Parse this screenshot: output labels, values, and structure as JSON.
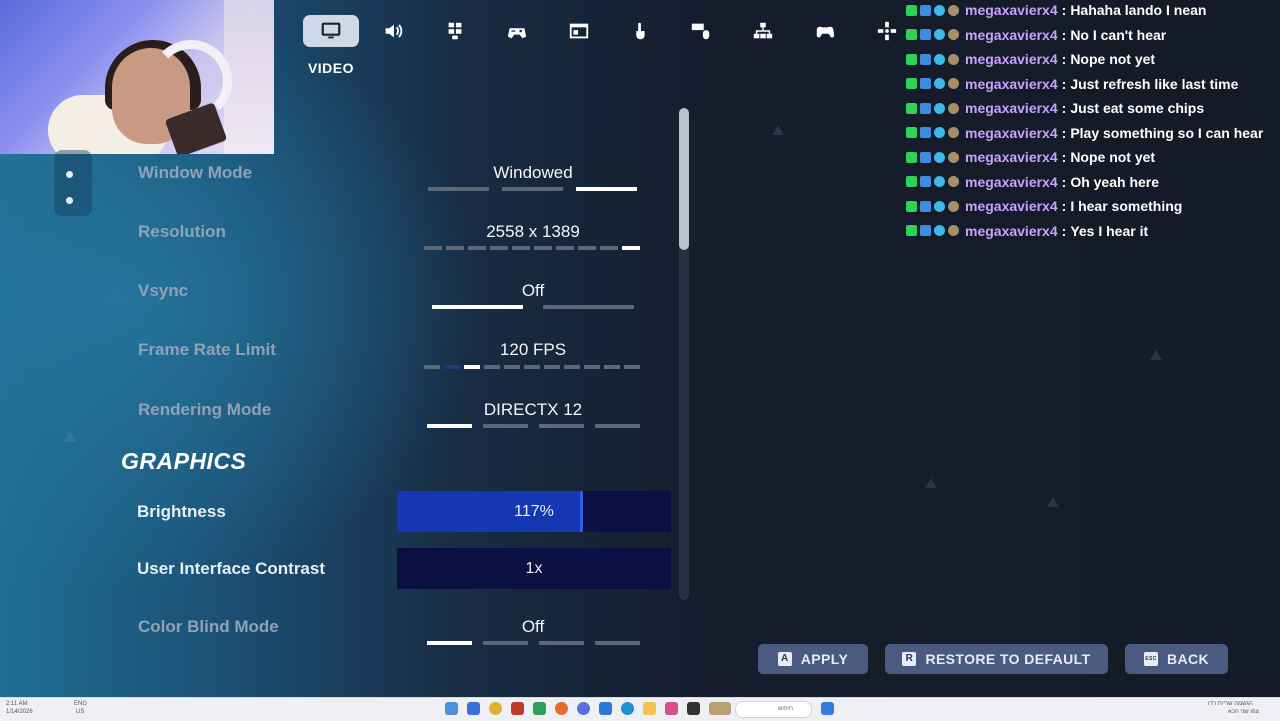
{
  "nav": {
    "active_tab_label": "VIDEO",
    "icons": [
      "monitor-icon",
      "speaker-icon",
      "controller-grid-icon",
      "gamepad-wireless-icon",
      "window-icon",
      "touch-icon",
      "keyboard-mouse-icon",
      "network-icon",
      "controller-icon",
      "gamepad-icon"
    ]
  },
  "settings": {
    "window_mode": {
      "label": "Window Mode",
      "value": "Windowed",
      "option_count": 3,
      "selected_index": 2
    },
    "resolution": {
      "label": "Resolution",
      "value": "2558 x 1389",
      "option_count": 10,
      "selected_index": 9
    },
    "vsync": {
      "label": "Vsync",
      "value": "Off",
      "option_count": 2,
      "selected_index": 0
    },
    "frame_rate_limit": {
      "label": "Frame Rate Limit",
      "value": "120 FPS",
      "option_count": 11,
      "selected_index": 2
    },
    "rendering_mode": {
      "label": "Rendering Mode",
      "value": "DIRECTX 12",
      "option_count": 4,
      "selected_index": 0
    }
  },
  "graphics": {
    "header": "GRAPHICS",
    "brightness": {
      "label": "Brightness",
      "value": "117%",
      "fill_fraction": 0.68
    },
    "ui_contrast": {
      "label": "User Interface Contrast",
      "value": "1x",
      "fill_fraction": 0.0
    },
    "color_blind_mode": {
      "label": "Color Blind Mode",
      "value": "Off",
      "option_count": 4,
      "selected_index": 0
    }
  },
  "chat": {
    "username": "megaxavierx4",
    "separator": ":",
    "messages": [
      "Hahaha lando I nean",
      "No I can't hear",
      "Nope not yet",
      "Just refresh like last time",
      "Just eat some chips",
      "Play something so I can hear",
      "Nope not yet",
      "Oh yeah here",
      "I hear something",
      "Yes I hear it"
    ]
  },
  "buttons": {
    "apply": {
      "key": "A",
      "label": "APPLY"
    },
    "restore": {
      "key": "R",
      "label": "RESTORE TO DEFAULT"
    },
    "back": {
      "key": "ESC",
      "label": "BACK"
    }
  },
  "taskbar": {
    "time": "2:11 AM",
    "date": "1/14/2026",
    "lang": "ENG",
    "region": "US",
    "search_placeholder": "חיפוש",
    "notification_text": "הגשמה שריית רדו",
    "notification_sub": "צפו שני הכא"
  },
  "colors": {
    "accent_blue": "#1637b3",
    "bar_track": "#0b0f42",
    "chat_username": "#c9a2ff",
    "button_bg": "#4a5a80"
  }
}
